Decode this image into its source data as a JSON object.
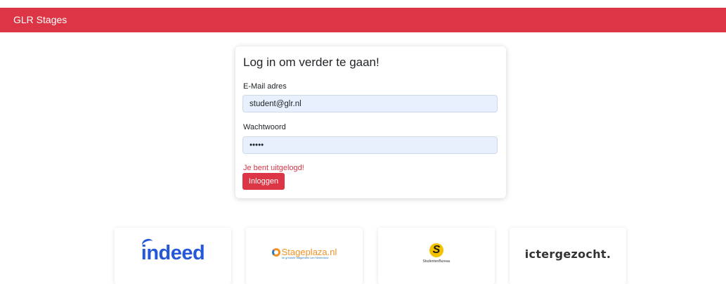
{
  "navbar": {
    "brand": "GLR Stages",
    "color": "#dc3545"
  },
  "login": {
    "title": "Log in om verder te gaan!",
    "email_label": "E-Mail adres",
    "email_value": "student@glr.nl",
    "password_label": "Wachtwoord",
    "password_value": "•••••",
    "message": "Je bent uitgelogd!",
    "submit_label": "Inloggen"
  },
  "partners": [
    {
      "name": "indeed",
      "icon": "indeed-logo"
    },
    {
      "name": "Stageplaza.nl",
      "icon": "stageplaza-logo",
      "tagline": "de grootste stagebank van Nederland"
    },
    {
      "name": "StudentenBureau",
      "icon": "studentenbureau-logo"
    },
    {
      "name": "ictergezocht.",
      "icon": "ictergezocht-logo"
    }
  ]
}
